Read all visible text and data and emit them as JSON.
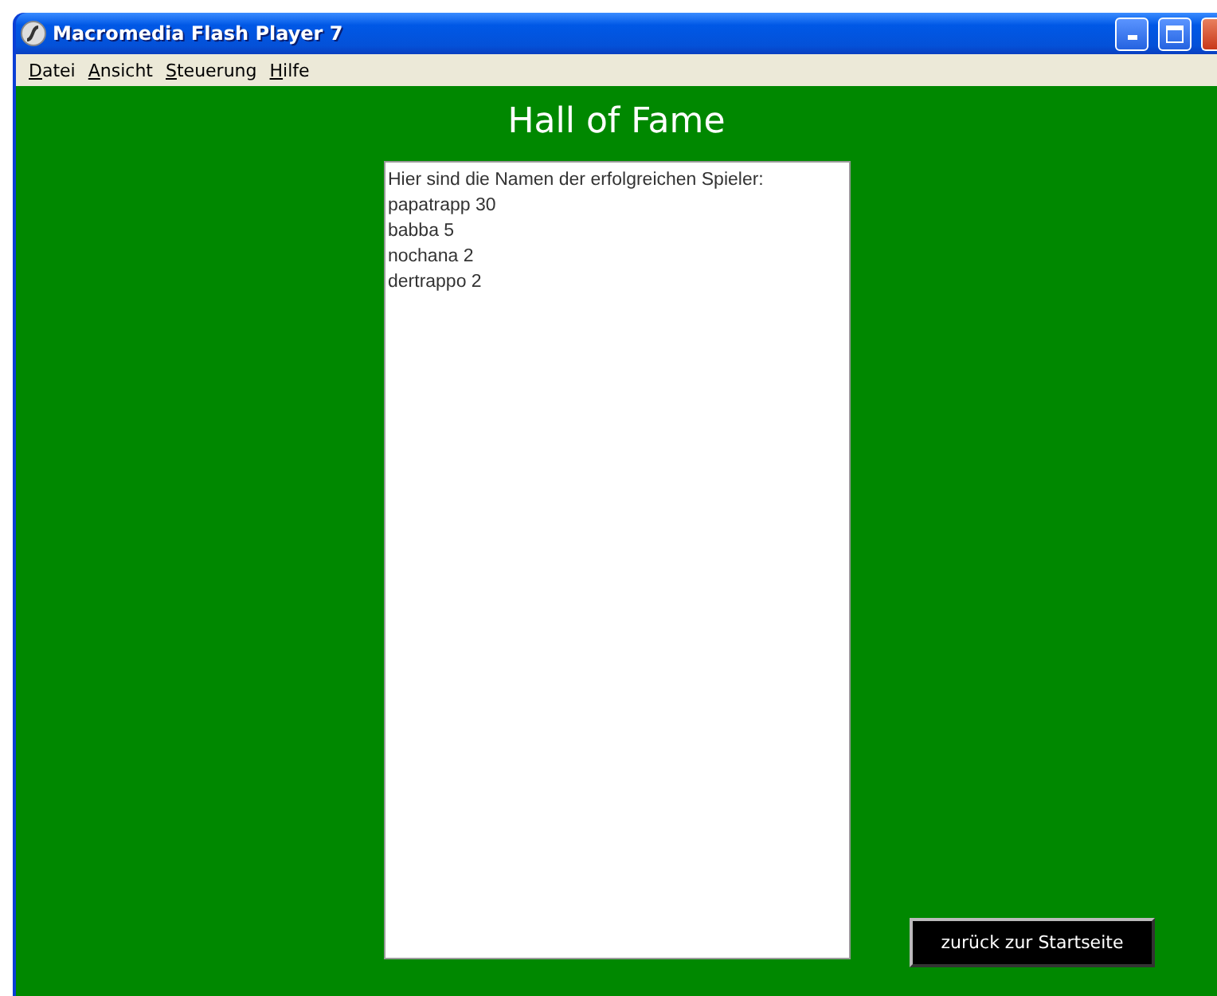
{
  "window": {
    "title": "Macromedia Flash Player 7"
  },
  "menu": [
    "Datei",
    "Ansicht",
    "Steuerung",
    "Hilfe"
  ],
  "heading": "Hall of Fame",
  "list": {
    "intro": "Hier sind die Namen der erfolgreichen Spieler:",
    "entries": [
      "papatrapp 30",
      "babba 5",
      "nochana 2",
      "dertrappo 2"
    ]
  },
  "button": "zurück zur Startseite"
}
